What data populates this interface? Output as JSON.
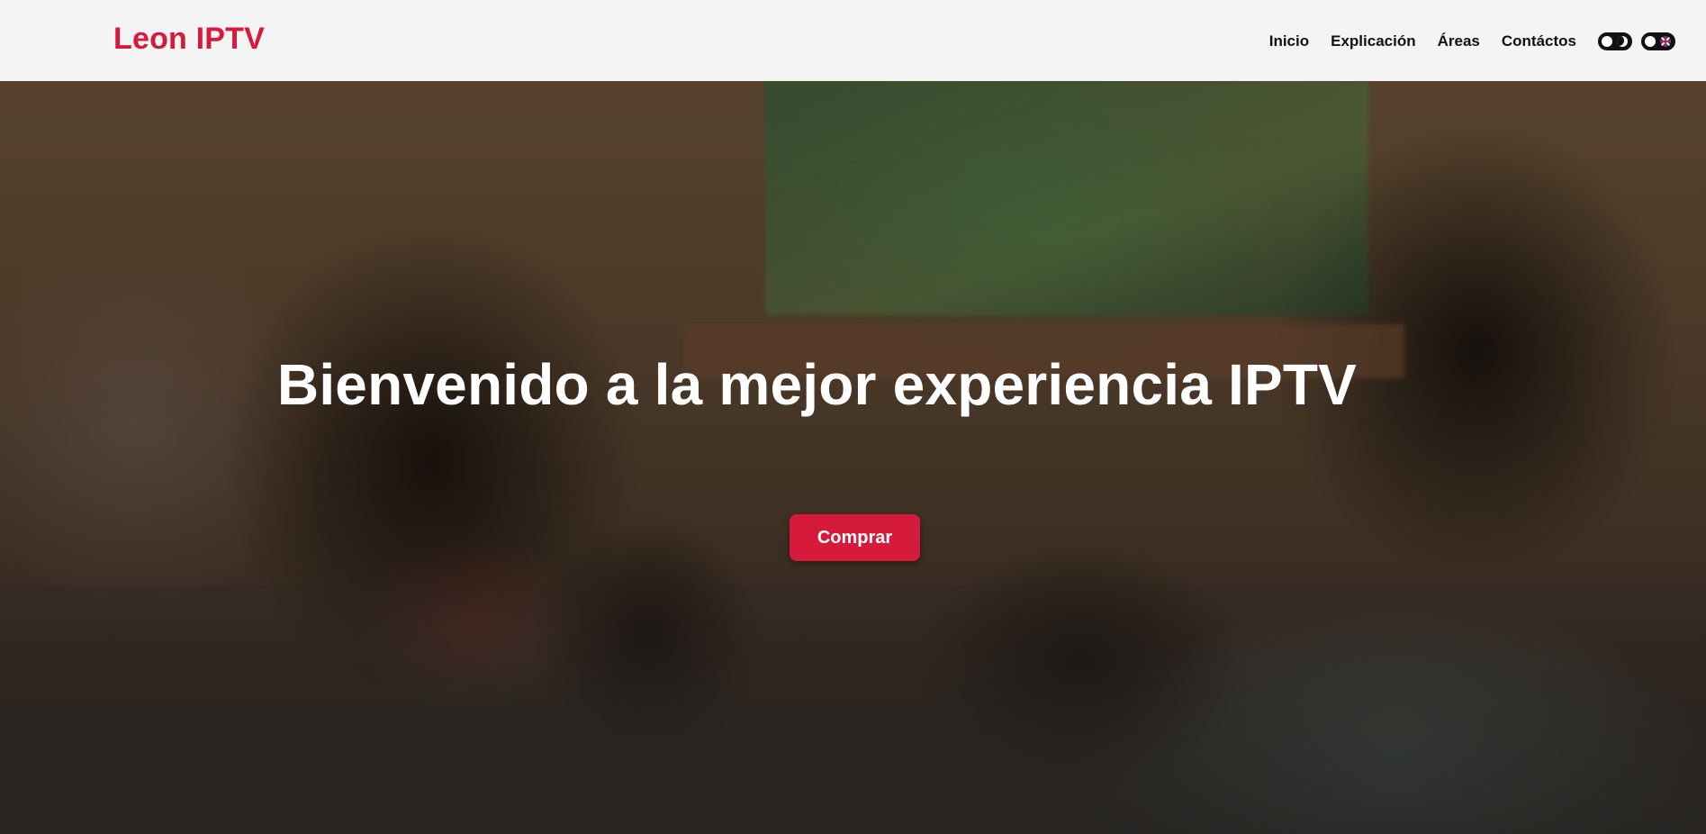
{
  "header": {
    "brand": "Leon IPTV",
    "nav": [
      {
        "label": "Inicio"
      },
      {
        "label": "Explicación"
      },
      {
        "label": "Áreas"
      },
      {
        "label": "Contáctos"
      }
    ],
    "toggles": [
      {
        "icon": "moon-icon",
        "state": "off"
      },
      {
        "icon": "uk-flag-icon",
        "state": "off"
      }
    ]
  },
  "hero": {
    "title": "Bienvenido a la mejor experiencia IPTV",
    "cta_label": "Comprar",
    "background": "family-watching-tv-photo"
  },
  "colors": {
    "accent": "#d61a3c",
    "header_bg": "#f4f4f4",
    "nav_text": "#111111",
    "hero_text": "#ffffff"
  }
}
